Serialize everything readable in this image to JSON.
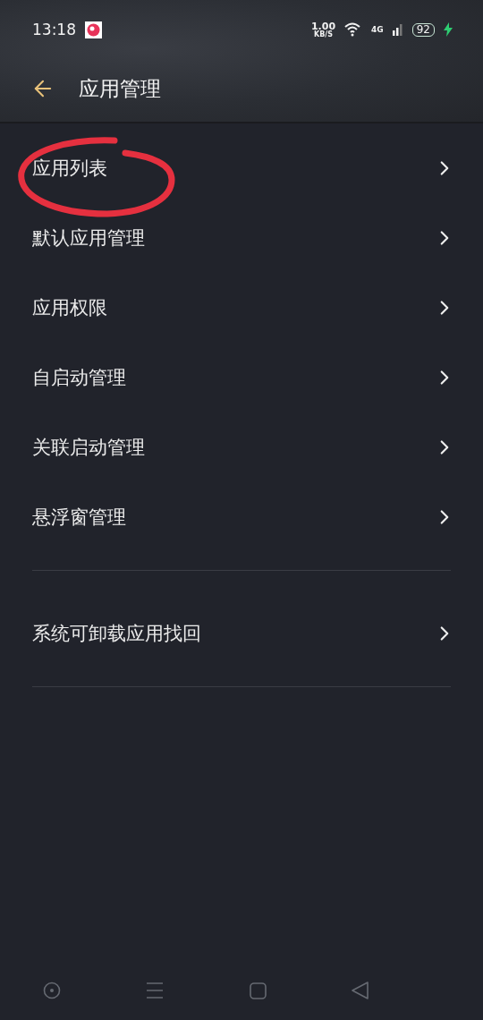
{
  "status_bar": {
    "time": "13:18",
    "speed": "1.00",
    "speed_unit": "KB/S",
    "network": "4G",
    "battery": "92",
    "charging": true
  },
  "header": {
    "title": "应用管理"
  },
  "sections": [
    {
      "items": [
        {
          "label": "应用列表",
          "circled": true
        },
        {
          "label": "默认应用管理",
          "circled": false
        },
        {
          "label": "应用权限",
          "circled": false
        },
        {
          "label": "自启动管理",
          "circled": false
        },
        {
          "label": "关联启动管理",
          "circled": false
        },
        {
          "label": "悬浮窗管理",
          "circled": false
        }
      ]
    },
    {
      "items": [
        {
          "label": "系统可卸载应用找回",
          "circled": false
        }
      ]
    }
  ]
}
